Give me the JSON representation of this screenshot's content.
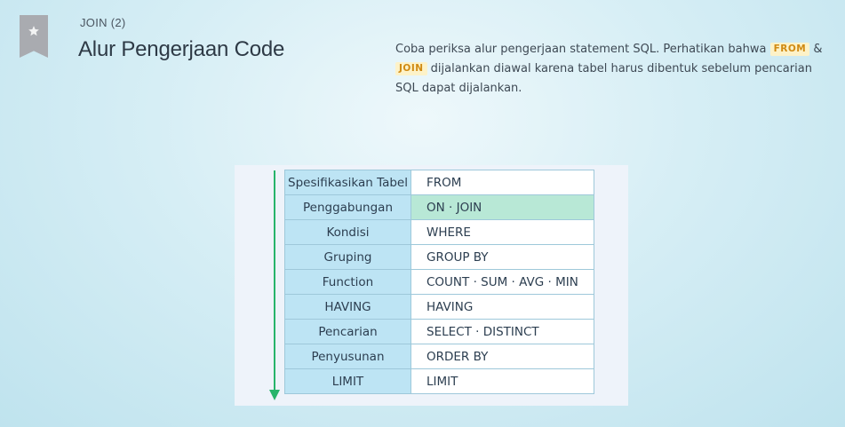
{
  "header": {
    "kicker": "JOIN (2)",
    "title": "Alur Pengerjaan Code"
  },
  "description": {
    "part1": "Coba periksa alur pengerjaan statement SQL. Perhatikan bahwa ",
    "tag1": "FROM",
    "part2": " & ",
    "tag2": "JOIN",
    "part3": " dijalankan diawal karena tabel harus dibentuk sebelum pencarian SQL dapat dijalankan."
  },
  "flow": {
    "rows": [
      {
        "step": "Spesifikasikan Tabel",
        "clause": "FROM"
      },
      {
        "step": "Penggabungan",
        "clause": "ON · JOIN"
      },
      {
        "step": "Kondisi",
        "clause": "WHERE"
      },
      {
        "step": "Gruping",
        "clause": "GROUP BY"
      },
      {
        "step": "Function",
        "clause": "COUNT · SUM · AVG · MIN"
      },
      {
        "step": "HAVING",
        "clause": "HAVING"
      },
      {
        "step": "Pencarian",
        "clause": "SELECT · DISTINCT"
      },
      {
        "step": "Penyusunan",
        "clause": "ORDER BY"
      },
      {
        "step": "LIMIT",
        "clause": "LIMIT"
      }
    ],
    "highlight_color": "#b8e8d6",
    "step_color": "#bde4f4",
    "arrow_color": "#27b46a"
  },
  "icons": {
    "bookmark": "bookmark-star-icon",
    "arrow": "arrow-down-icon"
  }
}
